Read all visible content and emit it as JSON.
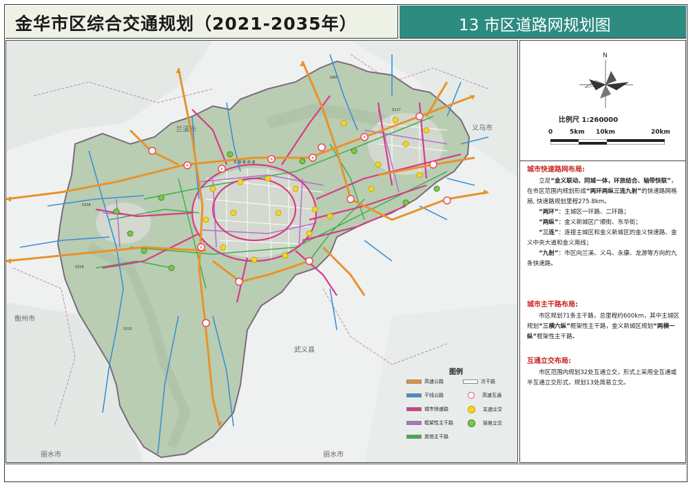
{
  "header": {
    "title": "金华市区综合交通规划（2021-2035年）",
    "map_title": "13 市区道路网规划图"
  },
  "scale": {
    "north": "N",
    "ratio": "比例尺 1:260000",
    "ticks": [
      "0",
      "5km",
      "10km",
      "20km"
    ]
  },
  "map_labels": {
    "quzhou": "衡州市",
    "lishui_w": "丽水市",
    "lishui_e": "丽水市",
    "wuyi": "武义县",
    "yiwu": "义乌市",
    "lanxi": "兰溪市"
  },
  "notes": {
    "s1_title": "城市快速路网布局:",
    "s1_p1_pre": "立足",
    "s1_p1_b1": "“金义联动、同城一体，环放结合、轴带快联”",
    "s1_p1_mid": "，在市区范围内规划形成",
    "s1_p1_b2": "“两环两纵三连九射”",
    "s1_p1_post": "的快速路网格局, 快速路规划里程275.8km。",
    "s1_l1_b": "“两环”",
    "s1_l1": "：主城区一环路、二环路；",
    "s1_l2_b": "“两纵”",
    "s1_l2": "：金义新城区广顺街、东华街；",
    "s1_l3_b": "“三连”",
    "s1_l3": "：连接主城区和金义新城区的金义快速路、金义中央大道和金义南线；",
    "s1_l4_b": "“九射”",
    "s1_l4": "：市区向兰溪、义乌、永康、龙游等方向的九条快速路。",
    "s2_title": "城市主干路布局:",
    "s2_p1": "市区规划71条主干路，总里程约600km，其中主城区规划",
    "s2_b1": "“三横六纵”",
    "s2_p2": "框架性主干路，金义新城区规划",
    "s2_b2": "“两横一纵”",
    "s2_p3": "框架性主干路。",
    "s3_title": "互通立交布局:",
    "s3_p1": "市区范围内规划32处互通立交，形式上采用全互通或半互通立交形式，规划13处简易立交。"
  },
  "legend": {
    "title": "图例",
    "items": [
      {
        "label": "高速公路",
        "color": "#e8922a",
        "kind": "line"
      },
      {
        "label": "次干路",
        "color": "#ffffff",
        "kind": "line"
      },
      {
        "label": "干线公路",
        "color": "#3a8fd8",
        "kind": "line"
      },
      {
        "label": "高速互通",
        "color": "#e84a5a",
        "kind": "node"
      },
      {
        "label": "城市快速路",
        "color": "#d63a8a",
        "kind": "line"
      },
      {
        "label": "互通立交",
        "color": "#f5d522",
        "kind": "node"
      },
      {
        "label": "框架性主干路",
        "color": "#b070d0",
        "kind": "line"
      },
      {
        "label": "简易立交",
        "color": "#7cc84a",
        "kind": "node"
      },
      {
        "label": "其他主干路",
        "color": "#3cb04a",
        "kind": "line"
      }
    ]
  },
  "colors": {
    "header_bg": "#eef1e6",
    "title_bar": "#2e8b80",
    "region_fill": "#b9cdb2",
    "section_title": "#c8231f"
  }
}
